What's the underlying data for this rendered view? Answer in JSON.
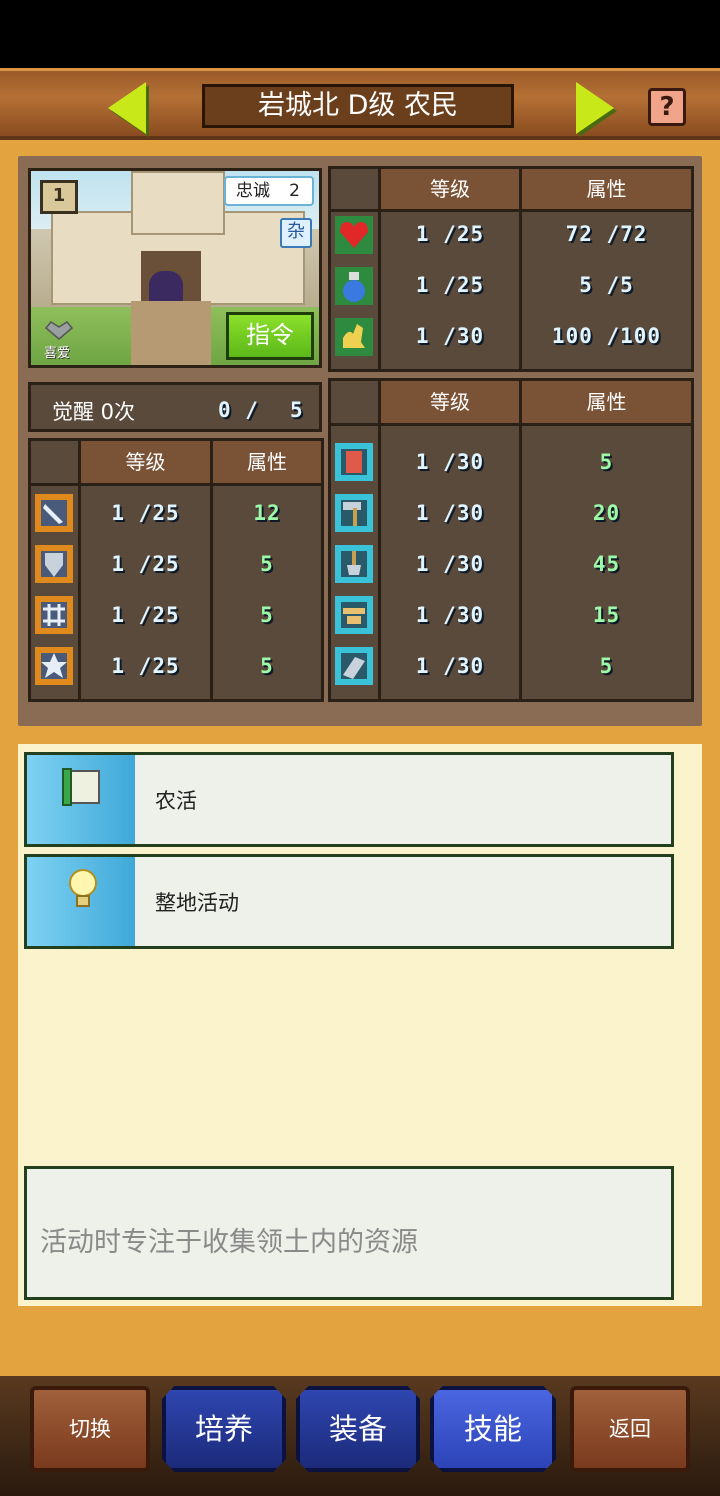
{
  "header": {
    "title": "岩城北 D级 农民",
    "help_label": "?"
  },
  "portrait": {
    "rank": "1",
    "loyalty_label": "忠诚",
    "loyalty_value": "2",
    "type_badge": "杂",
    "like_label": "喜爱",
    "order_button": "指令"
  },
  "top_stats": {
    "headers": [
      "等级",
      "属性"
    ],
    "rows": [
      {
        "icon": "heart-icon",
        "level": "1 /25",
        "value": "72 /72"
      },
      {
        "icon": "potion-icon",
        "level": "1 /25",
        "value": "5 /5"
      },
      {
        "icon": "stamina-icon",
        "level": "1 /30",
        "value": "100 /100"
      }
    ]
  },
  "awaken": {
    "label": "觉醒 0次",
    "current": "0 /",
    "max": "5"
  },
  "combat_stats": {
    "headers": [
      "等级",
      "属性"
    ],
    "rows": [
      {
        "icon": "sword-icon",
        "level": "1 /25",
        "value": "12"
      },
      {
        "icon": "shield-icon",
        "level": "1 /25",
        "value": "5"
      },
      {
        "icon": "dexterity-icon",
        "level": "1 /25",
        "value": "5"
      },
      {
        "icon": "star-icon",
        "level": "1 /25",
        "value": "5"
      }
    ]
  },
  "work_stats": {
    "headers": [
      "等级",
      "属性"
    ],
    "rows": [
      {
        "icon": "book-icon",
        "level": "1 /30",
        "value": "5"
      },
      {
        "icon": "hammer-icon",
        "level": "1 /30",
        "value": "20"
      },
      {
        "icon": "shovel-icon",
        "level": "1 /30",
        "value": "45"
      },
      {
        "icon": "anvil-icon",
        "level": "1 /30",
        "value": "15"
      },
      {
        "icon": "craft-icon",
        "level": "1 /30",
        "value": "5"
      }
    ]
  },
  "skills": [
    {
      "icon": "scroll-icon",
      "label": "农活"
    },
    {
      "icon": "lightbulb-icon",
      "label": "整地活动"
    }
  ],
  "description": "活动时专注于收集领土内的资源",
  "nav": {
    "switch": "切换",
    "train": "培养",
    "equip": "装备",
    "skill": "技能",
    "back": "返回"
  }
}
